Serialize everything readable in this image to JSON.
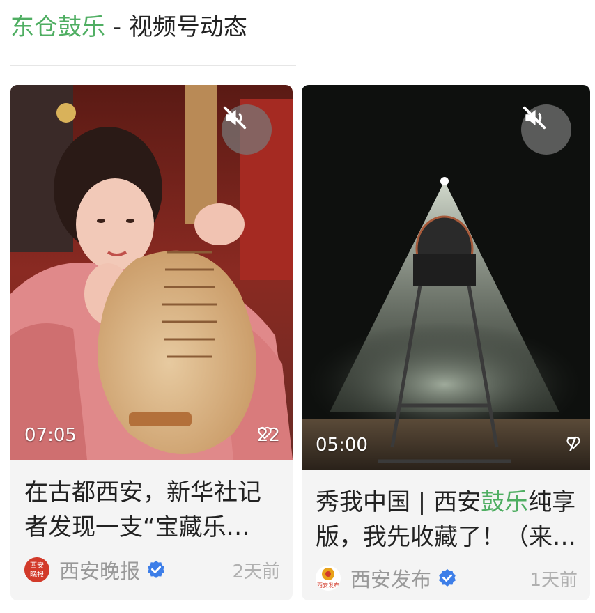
{
  "header": {
    "account": "东仓鼓乐",
    "suffix": " - 视频号动态"
  },
  "cards": [
    {
      "duration": "07:05",
      "likes": "22",
      "title": "在古都西安，新华社记者发现一支“宝藏乐…",
      "source": "西安晚报",
      "avatar_text": "西安晚报",
      "time": "2天前",
      "thumbnail": "woman-playing-pipa"
    },
    {
      "duration": "05:00",
      "likes": "7",
      "title_pre": "秀我中国 | 西安",
      "title_hl": "鼓乐",
      "title_post": "纯享版，我先收藏了！（来…",
      "source": "西安发布",
      "avatar_text": "西安发布",
      "time": "1天前",
      "thumbnail": "drum-under-spotlight"
    }
  ],
  "icons": [
    "mute-icon",
    "heart-icon",
    "verified-icon"
  ],
  "colors": {
    "accent": "#4fae62",
    "verified": "#3d7ee8"
  }
}
